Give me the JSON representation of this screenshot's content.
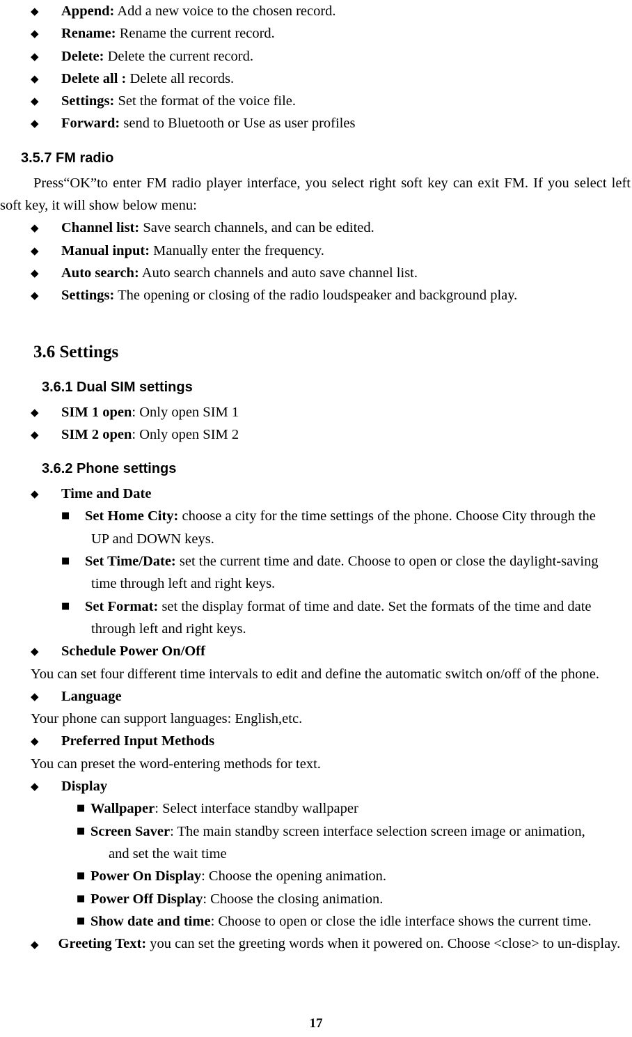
{
  "page": {
    "number": "17",
    "bullet_glyphs": {
      "diamond": "◆",
      "square": "■"
    }
  },
  "voice_record_options": [
    {
      "term": "Append:",
      "desc": " Add a new voice to the chosen record."
    },
    {
      "term": "Rename:",
      "desc": " Rename the current record."
    },
    {
      "term": "Delete:",
      "desc": " Delete the current record."
    },
    {
      "term": "Delete all :",
      "desc": " Delete all records."
    },
    {
      "term": "Settings:",
      "desc": " Set the format of the voice file."
    },
    {
      "term": "Forward:",
      "desc": " send to Bluetooth or Use as user profiles"
    }
  ],
  "fm_radio": {
    "heading": "3.5.7 FM radio",
    "intro": "Press“OK”to enter FM radio player interface, you select right soft key can exit FM. If you select left soft key, it will show below menu:",
    "options": [
      {
        "term": "Channel list:",
        "desc": " Save search channels, and can be edited."
      },
      {
        "term": "Manual input:",
        "desc": " Manually enter the frequency."
      },
      {
        "term": "Auto search:",
        "desc": " Auto search channels and auto save channel list."
      },
      {
        "term": "Settings:",
        "desc": " The opening or closing of the radio loudspeaker and background play."
      }
    ]
  },
  "settings": {
    "heading": "3.6 Settings",
    "dual_sim": {
      "heading": "3.6.1 Dual SIM settings",
      "options": [
        {
          "term": "SIM 1 open",
          "desc": ": Only open SIM 1"
        },
        {
          "term": "SIM 2 open",
          "desc": ": Only open SIM 2"
        }
      ]
    },
    "phone_settings": {
      "heading": "3.6.2 Phone settings",
      "time_and_date": {
        "term": "Time and Date",
        "sub_items": [
          {
            "term": "Set Home City:",
            "desc": " choose a city for the time settings of the phone. Choose City through the",
            "wrap": "UP and DOWN keys."
          },
          {
            "term": "Set Time/Date:",
            "desc": " set the current time and date. Choose to open or close the daylight-saving",
            "wrap": "time through left and right keys."
          },
          {
            "term": "Set Format:",
            "desc": " set the display format of time and date. Set the formats of the time and date",
            "wrap": "through left and right keys."
          }
        ]
      },
      "schedule_power": {
        "term": "Schedule Power On/Off",
        "body": "You can set four different time intervals to edit and define the automatic switch on/off of the phone."
      },
      "language": {
        "term": "Language",
        "body": "Your phone can support languages: English,etc."
      },
      "input_methods": {
        "term": "Preferred Input Methods",
        "body": "You can preset the word-entering methods for text."
      },
      "display": {
        "term": "Display",
        "sub_items": [
          {
            "term": "Wallpaper",
            "desc": ": Select interface standby wallpaper",
            "wrap": ""
          },
          {
            "term": "Screen Saver",
            "desc": ": The main standby screen interface selection screen image or animation,",
            "wrap": "and set the wait time"
          },
          {
            "term": "Power On Display",
            "desc": ": Choose the opening animation.",
            "wrap": ""
          },
          {
            "term": "Power Off Display",
            "desc": ": Choose the closing animation.",
            "wrap": ""
          },
          {
            "term": "Show date and time",
            "desc": ": Choose to open or close the idle interface shows the current time.",
            "wrap": ""
          }
        ]
      },
      "greeting_text": {
        "term": "Greeting Text:",
        "body": " you can set the greeting words when it powered on. Choose <close> to un-display."
      }
    }
  }
}
